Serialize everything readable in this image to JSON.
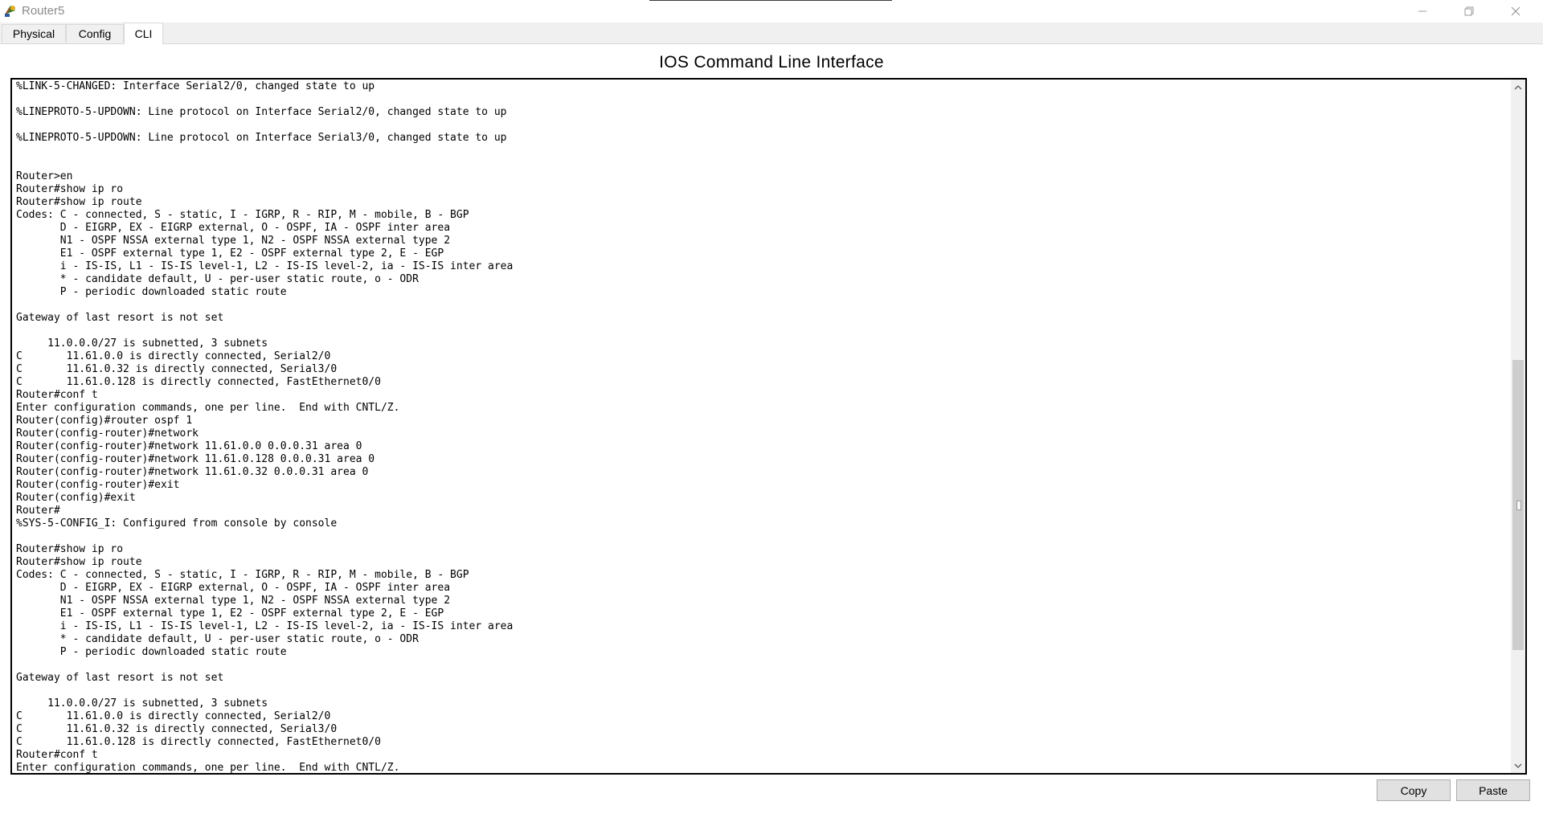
{
  "window": {
    "title": "Router5",
    "minimize_icon": "minimize-icon",
    "maximize_icon": "restore-icon",
    "close_icon": "close-icon"
  },
  "tabs": [
    {
      "label": "Physical",
      "selected": false
    },
    {
      "label": "Config",
      "selected": false
    },
    {
      "label": "CLI",
      "selected": true
    }
  ],
  "panel": {
    "title": "IOS Command Line Interface"
  },
  "console": {
    "text": "%LINK-5-CHANGED: Interface Serial2/0, changed state to up\n\n%LINEPROTO-5-UPDOWN: Line protocol on Interface Serial2/0, changed state to up\n\n%LINEPROTO-5-UPDOWN: Line protocol on Interface Serial3/0, changed state to up\n\n\nRouter>en\nRouter#show ip ro\nRouter#show ip route\nCodes: C - connected, S - static, I - IGRP, R - RIP, M - mobile, B - BGP\n       D - EIGRP, EX - EIGRP external, O - OSPF, IA - OSPF inter area\n       N1 - OSPF NSSA external type 1, N2 - OSPF NSSA external type 2\n       E1 - OSPF external type 1, E2 - OSPF external type 2, E - EGP\n       i - IS-IS, L1 - IS-IS level-1, L2 - IS-IS level-2, ia - IS-IS inter area\n       * - candidate default, U - per-user static route, o - ODR\n       P - periodic downloaded static route\n\nGateway of last resort is not set\n\n     11.0.0.0/27 is subnetted, 3 subnets\nC       11.61.0.0 is directly connected, Serial2/0\nC       11.61.0.32 is directly connected, Serial3/0\nC       11.61.0.128 is directly connected, FastEthernet0/0\nRouter#conf t\nEnter configuration commands, one per line.  End with CNTL/Z.\nRouter(config)#router ospf 1\nRouter(config-router)#network\nRouter(config-router)#network 11.61.0.0 0.0.0.31 area 0\nRouter(config-router)#network 11.61.0.128 0.0.0.31 area 0\nRouter(config-router)#network 11.61.0.32 0.0.0.31 area 0\nRouter(config-router)#exit\nRouter(config)#exit\nRouter#\n%SYS-5-CONFIG_I: Configured from console by console\n\nRouter#show ip ro\nRouter#show ip route\nCodes: C - connected, S - static, I - IGRP, R - RIP, M - mobile, B - BGP\n       D - EIGRP, EX - EIGRP external, O - OSPF, IA - OSPF inter area\n       N1 - OSPF NSSA external type 1, N2 - OSPF NSSA external type 2\n       E1 - OSPF external type 1, E2 - OSPF external type 2, E - EGP\n       i - IS-IS, L1 - IS-IS level-1, L2 - IS-IS level-2, ia - IS-IS inter area\n       * - candidate default, U - per-user static route, o - ODR\n       P - periodic downloaded static route\n\nGateway of last resort is not set\n\n     11.0.0.0/27 is subnetted, 3 subnets\nC       11.61.0.0 is directly connected, Serial2/0\nC       11.61.0.32 is directly connected, Serial3/0\nC       11.61.0.128 is directly connected, FastEthernet0/0\nRouter#conf t\nEnter configuration commands, one per line.  End with CNTL/Z."
  },
  "buttons": {
    "copy_label": "Copy",
    "paste_label": "Paste"
  },
  "colors": {
    "window_bg": "#f0f0f0",
    "console_bg": "#ffffff",
    "console_text": "#000000"
  }
}
